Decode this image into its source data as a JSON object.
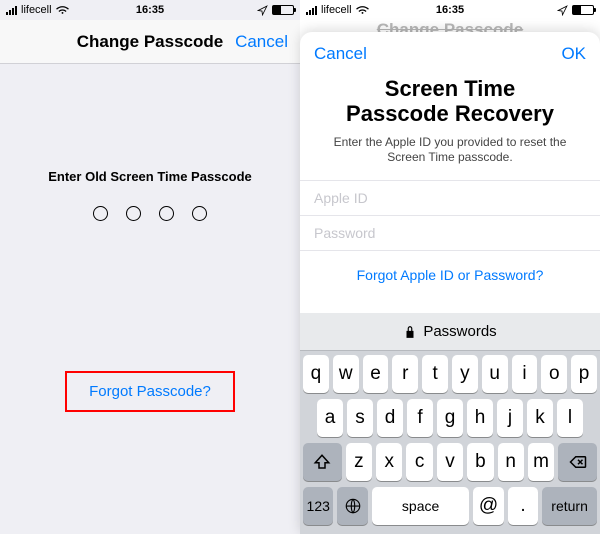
{
  "left": {
    "status": {
      "carrier": "lifecell",
      "time": "16:35"
    },
    "nav": {
      "title": "Change Passcode",
      "cancel": "Cancel"
    },
    "prompt": "Enter Old Screen Time Passcode",
    "forgot": "Forgot Passcode?"
  },
  "right": {
    "status": {
      "carrier": "lifecell",
      "time": "16:35"
    },
    "faded_title": "Change Passcode",
    "sheet": {
      "cancel": "Cancel",
      "ok": "OK",
      "title_line1": "Screen Time",
      "title_line2": "Passcode Recovery",
      "subtitle": "Enter the Apple ID you provided to reset the Screen Time passcode.",
      "apple_id_placeholder": "Apple ID",
      "password_placeholder": "Password",
      "forgot": "Forgot Apple ID or Password?"
    },
    "keyboard": {
      "suggestion": "Passwords",
      "row1": [
        "q",
        "w",
        "e",
        "r",
        "t",
        "y",
        "u",
        "i",
        "o",
        "p"
      ],
      "row2": [
        "a",
        "s",
        "d",
        "f",
        "g",
        "h",
        "j",
        "k",
        "l"
      ],
      "row3": [
        "z",
        "x",
        "c",
        "v",
        "b",
        "n",
        "m"
      ],
      "num": "123",
      "space": "space",
      "at": "@",
      "dot": ".",
      "return": "return"
    }
  }
}
